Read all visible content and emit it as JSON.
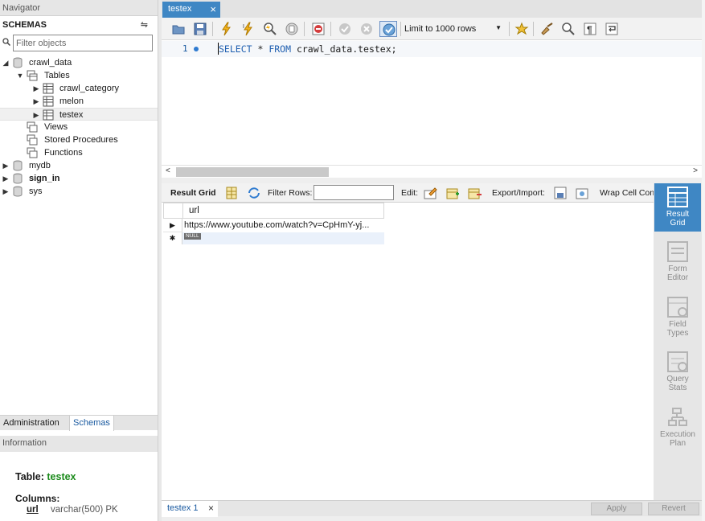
{
  "navigator": {
    "title": "Navigator",
    "schemas_label": "SCHEMAS",
    "filter_placeholder": "Filter objects",
    "tree": {
      "db1": "crawl_data",
      "tables": "Tables",
      "t1": "crawl_category",
      "t2": "melon",
      "t3": "testex",
      "views": "Views",
      "procs": "Stored Procedures",
      "funcs": "Functions",
      "db2": "mydb",
      "db3": "sign_in",
      "db4": "sys"
    },
    "tabs": {
      "admin": "Administration",
      "schemas": "Schemas"
    }
  },
  "info": {
    "title": "Information",
    "table_prefix": "Table:",
    "table_name": "testex",
    "columns_label": "Columns:",
    "col_name": "url",
    "col_type": "varchar(500) PK"
  },
  "editor": {
    "tab_label": "testex",
    "limit_select": "Limit to 1000 rows",
    "line_no": "1",
    "sql_kw1": "SELECT",
    "sql_mid": " * ",
    "sql_kw2": "FROM",
    "sql_rest": " crawl_data.testex;"
  },
  "results": {
    "result_grid": "Result Grid",
    "filter_rows": "Filter Rows:",
    "edit": "Edit:",
    "export_import": "Export/Import:",
    "wrap": "Wrap Cell Content",
    "column": "url",
    "row1": "https://www.youtube.com/watch?v=CpHmY-yj...",
    "null": "NULL",
    "side": {
      "grid": [
        "Result",
        "Grid"
      ],
      "form": [
        "Form",
        "Editor"
      ],
      "field": [
        "Field",
        "Types"
      ],
      "query": [
        "Query",
        "Stats"
      ],
      "exec": [
        "Execution",
        "Plan"
      ]
    },
    "bottom_tab": "testex 1",
    "apply": "Apply",
    "revert": "Revert"
  }
}
